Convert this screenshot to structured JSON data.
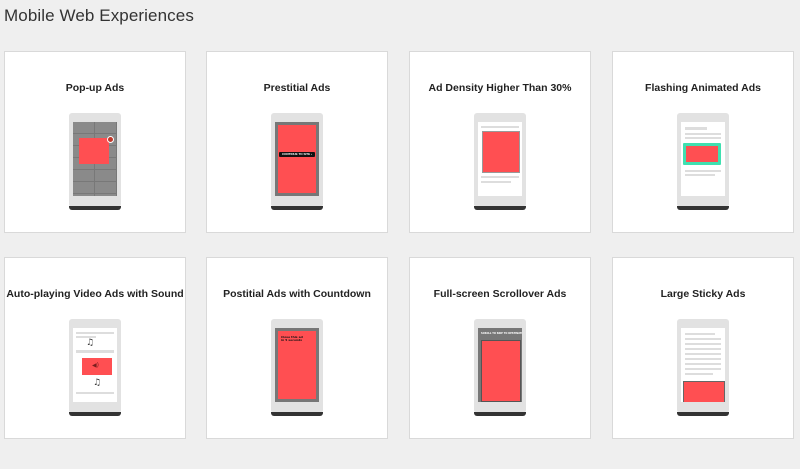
{
  "page": {
    "title": "Mobile Web Experiences"
  },
  "cards": [
    {
      "title": "Pop-up Ads"
    },
    {
      "title": "Prestitial Ads",
      "overlay_button": "CONTINUE TO SITE ›"
    },
    {
      "title": "Ad Density Higher Than 30%"
    },
    {
      "title": "Flashing Animated Ads"
    },
    {
      "title": "Auto-playing Video Ads with Sound"
    },
    {
      "title": "Postitial Ads with Countdown",
      "countdown_text": "Close this ad in 5 seconds"
    },
    {
      "title": "Full-screen Scrollover Ads",
      "scroll_text": "SCROLL TO SKIP TO DESTINATION"
    },
    {
      "title": "Large Sticky Ads"
    }
  ],
  "colors": {
    "ad_red": "#ff4f52",
    "flash_green": "#3fe0b0",
    "card_bg": "#ffffff",
    "page_bg": "#efefef"
  },
  "icons": [
    "close-icon",
    "music-note-icon",
    "speaker-icon"
  ]
}
